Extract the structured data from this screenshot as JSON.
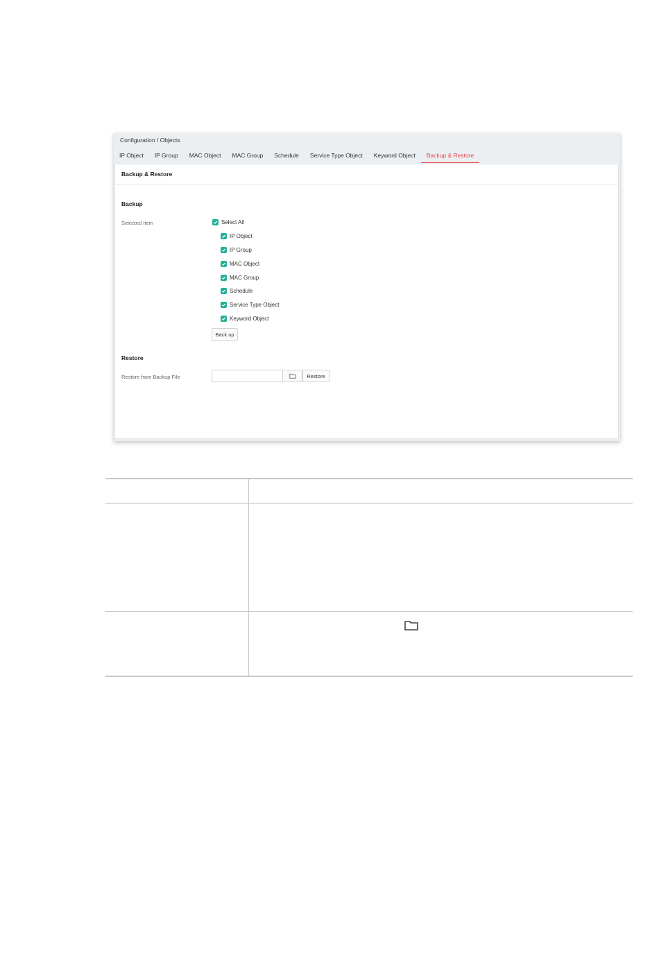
{
  "breadcrumb": "Configuration / Objects",
  "tabs": [
    {
      "label": "IP Object",
      "active": false
    },
    {
      "label": "IP Group",
      "active": false
    },
    {
      "label": "MAC Object",
      "active": false
    },
    {
      "label": "MAC Group",
      "active": false
    },
    {
      "label": "Schedule",
      "active": false
    },
    {
      "label": "Service Type Object",
      "active": false
    },
    {
      "label": "Keyword Object",
      "active": false
    },
    {
      "label": "Backup & Restore",
      "active": true
    }
  ],
  "page_title": "Backup & Restore",
  "backup": {
    "section_title": "Backup",
    "selected_item_label": "Selected Item",
    "select_all": {
      "label": "Select All",
      "checked": true
    },
    "items": [
      {
        "label": "IP Object",
        "checked": true
      },
      {
        "label": "IP Group",
        "checked": true
      },
      {
        "label": "MAC Object",
        "checked": true
      },
      {
        "label": "MAC Group",
        "checked": true
      },
      {
        "label": "Schedule",
        "checked": true
      },
      {
        "label": "Service Type Object",
        "checked": true
      },
      {
        "label": "Keyword Object",
        "checked": true
      }
    ],
    "button_label": "Back up"
  },
  "restore": {
    "section_title": "Restore",
    "file_label": "Restore from Backup File",
    "file_value": "",
    "browse_icon": "folder-icon",
    "button_label": "Restore"
  },
  "colors": {
    "accent": "#e2474b",
    "checkbox": "#1fb197",
    "header_bg": "#eceff2"
  },
  "table_icon": "folder-icon"
}
